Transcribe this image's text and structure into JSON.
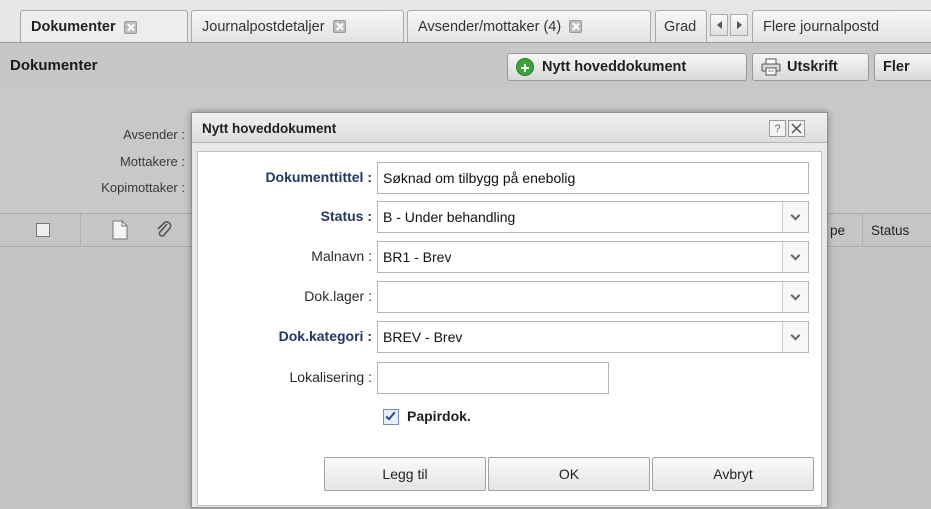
{
  "tabs": [
    {
      "label": "Dokumenter",
      "active": true,
      "closable": true
    },
    {
      "label": "Journalpostdetaljer",
      "active": false,
      "closable": true
    },
    {
      "label": "Avsender/mottaker (4)",
      "active": false,
      "closable": true
    },
    {
      "label": "Grad",
      "active": false,
      "closable": false
    },
    {
      "label": "Flere journalpostd",
      "active": false,
      "closable": false
    }
  ],
  "panel": {
    "title": "Dokumenter",
    "toolbar": {
      "new_main_doc": "Nytt hoveddokument",
      "print": "Utskrift",
      "more": "Fler"
    },
    "meta_labels": [
      "Avsender :",
      "Mottakere :",
      "Kopimottaker :"
    ],
    "grid_columns": [
      "pe",
      "Status"
    ]
  },
  "dialog": {
    "title": "Nytt hoveddokument",
    "help_btn": "?",
    "fields": {
      "title_label": "Dokumenttittel :",
      "title_value": "Søknad om tilbygg på enebolig",
      "status_label": "Status :",
      "status_value": "B - Under behandling",
      "template_label": "Malnavn :",
      "template_value": "BR1 - Brev",
      "storage_label": "Dok.lager :",
      "storage_value": "",
      "category_label": "Dok.kategori :",
      "category_value": "BREV - Brev",
      "location_label": "Lokalisering :",
      "location_value": ""
    },
    "paper_doc_label": "Papirdok.",
    "paper_doc_checked": true,
    "buttons": {
      "add": "Legg til",
      "ok": "OK",
      "cancel": "Avbryt"
    }
  },
  "colors": {
    "background": "#dcdcdc",
    "panel": "#c8c8c8",
    "dialog_body": "#ffffff",
    "bold_label": "#203864",
    "plus_green": "#3aa53a"
  }
}
